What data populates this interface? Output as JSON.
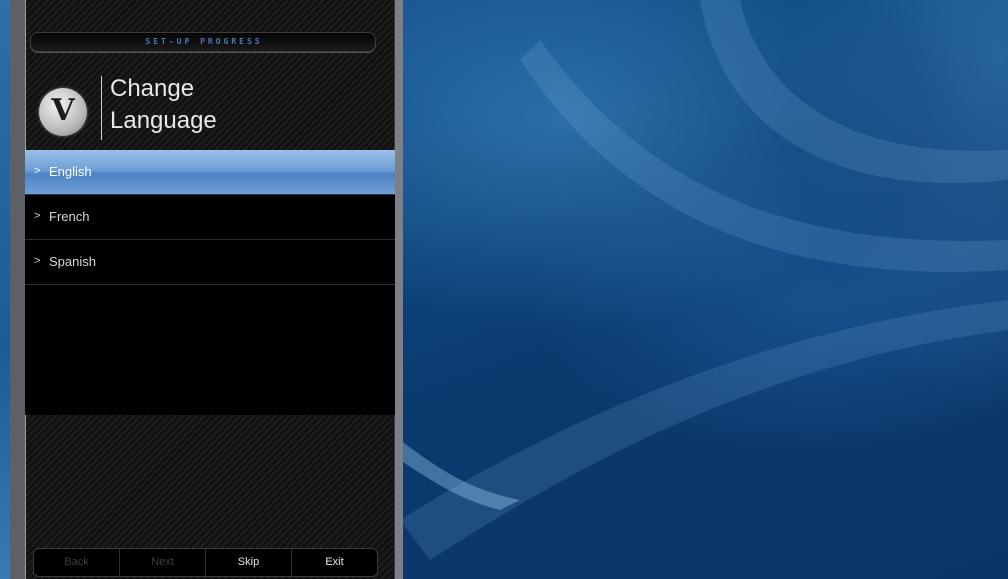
{
  "setup": {
    "progress_label": "SET-UP PROGRESS",
    "title_line1": "Change",
    "title_line2": "Language",
    "logo_letter": "V"
  },
  "menu": {
    "arrow": ">",
    "items": [
      {
        "label": "English",
        "selected": true
      },
      {
        "label": "French",
        "selected": false
      },
      {
        "label": "Spanish",
        "selected": false
      }
    ]
  },
  "buttons": [
    {
      "label": "Back",
      "enabled": false
    },
    {
      "label": "Next",
      "enabled": false
    },
    {
      "label": "Skip",
      "enabled": true
    },
    {
      "label": "Exit",
      "enabled": true
    }
  ],
  "colors": {
    "selection_highlight": "#6d9fd6",
    "progress_text": "#4b78b5",
    "wallpaper_blue": "#0e4a84"
  }
}
